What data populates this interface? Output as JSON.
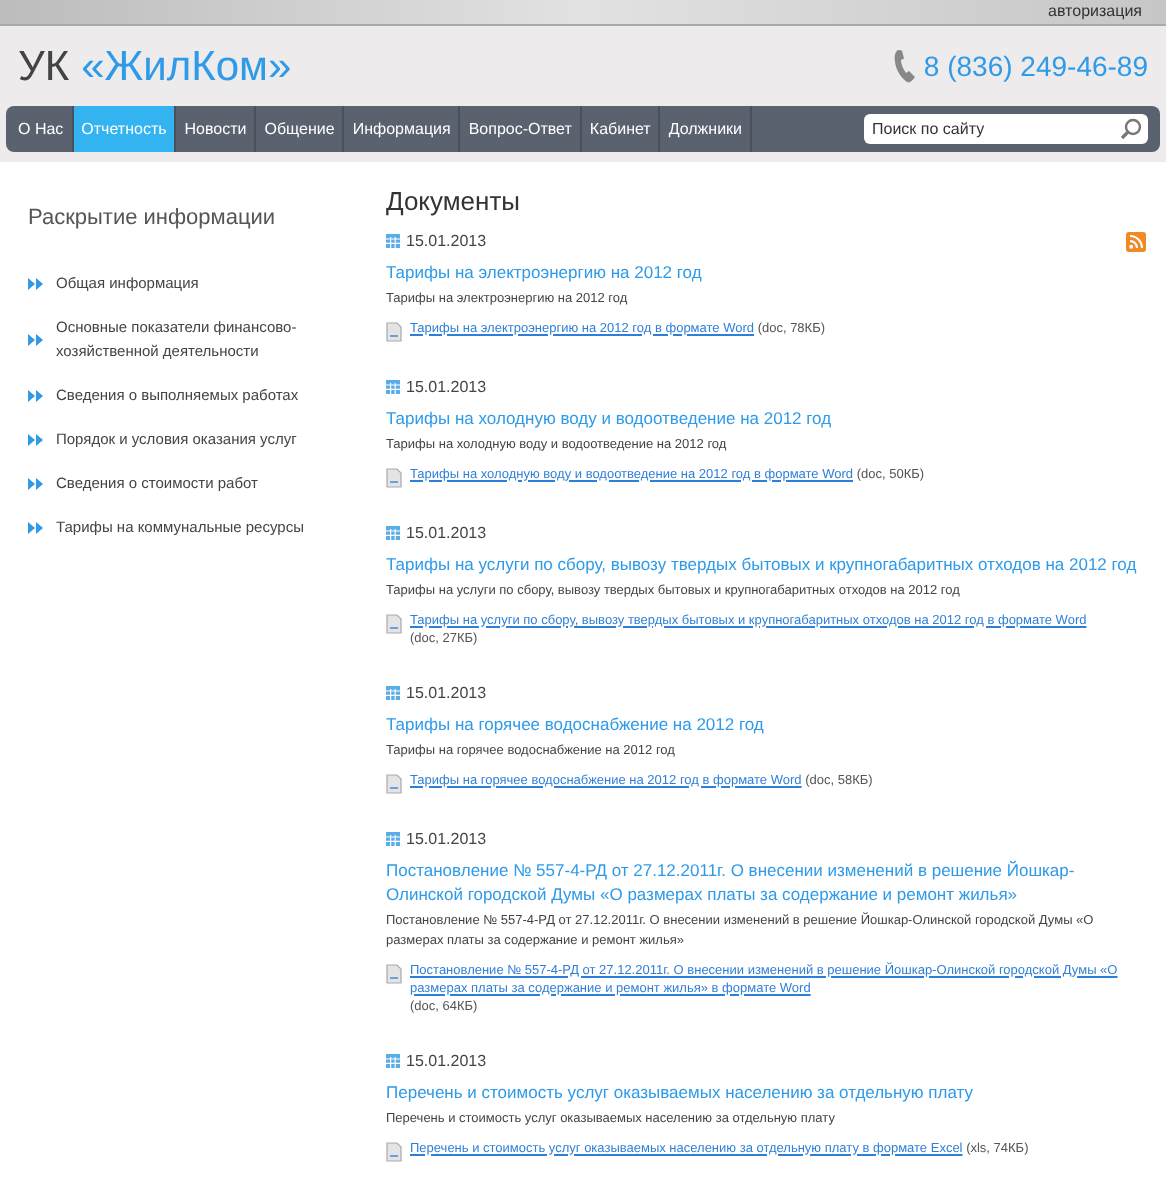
{
  "top_bar": {
    "login_link": "авторизация"
  },
  "header": {
    "logo_prefix": "УК",
    "logo_name": "«ЖилКом»",
    "phone": "8 (836) 249-46-89"
  },
  "nav": {
    "items": [
      {
        "label": "О Нас",
        "selected": false
      },
      {
        "label": "Отчетность",
        "selected": true
      },
      {
        "label": "Новости",
        "selected": false
      },
      {
        "label": "Общение",
        "selected": false
      },
      {
        "label": "Информация",
        "selected": false
      },
      {
        "label": "Вопрос-Ответ",
        "selected": false
      },
      {
        "label": "Кабинет",
        "selected": false
      },
      {
        "label": "Должники",
        "selected": false
      }
    ],
    "search": {
      "placeholder": "Поиск по сайту"
    }
  },
  "sidebar": {
    "title": "Раскрытие информации",
    "items": [
      "Общая информация",
      "Основные показатели финансово-хозяйственной деятельности",
      "Сведения о выполняемых работах",
      "Порядок и условия оказания услуг",
      "Сведения о стоимости работ",
      "Тарифы на коммунальные ресурсы"
    ]
  },
  "main": {
    "title": "Документы",
    "documents": [
      {
        "date": "15.01.2013",
        "title": "Тарифы на электроэнергию на 2012 год",
        "description": "Тарифы на электроэнергию на 2012 год",
        "file_link": "Тарифы на электроэнергию на 2012 год в формате Word",
        "file_info": "(doc, 78КБ)"
      },
      {
        "date": "15.01.2013",
        "title": "Тарифы на холодную воду и водоотведение на 2012 год",
        "description": "Тарифы на холодную воду и водоотведение на 2012 год",
        "file_link": "Тарифы на холодную воду и водоотведение на 2012 год в формате Word",
        "file_info": "(doc, 50КБ)"
      },
      {
        "date": "15.01.2013",
        "title": "Тарифы на услуги по сбору, вывозу твердых бытовых и крупногабаритных отходов на 2012 год",
        "description": "Тарифы на услуги по сбору, вывозу твердых бытовых и крупногабаритных отходов на 2012 год",
        "file_link": "Тарифы на услуги по сбору, вывозу твердых бытовых и крупногабаритных отходов на 2012 год в формате Word",
        "file_info": "(doc, 27КБ)"
      },
      {
        "date": "15.01.2013",
        "title": "Тарифы на горячее водоснабжение на 2012 год",
        "description": "Тарифы на горячее водоснабжение на 2012 год",
        "file_link": "Тарифы на горячее водоснабжение на 2012 год в формате Word",
        "file_info": "(doc, 58КБ)"
      },
      {
        "date": "15.01.2013",
        "title": "Постановление № 557-4-РД от 27.12.2011г. О внесении изменений в решение Йошкар-Олинской городской Думы «О размерах платы за содержание и ремонт жилья»",
        "description": "Постановление № 557-4-РД от 27.12.2011г. О внесении изменений в решение Йошкар-Олинской городской Думы «О размерах платы за содержание и ремонт жилья»",
        "file_link": "Постановление № 557-4-РД от 27.12.2011г. О внесении изменений в решение Йошкар-Олинской городской Думы «О размерах платы за содержание и ремонт жилья» в формате Word",
        "file_info": "(doc, 64КБ)"
      },
      {
        "date": "15.01.2013",
        "title": "Перечень и стоимость услуг оказываемых населению за отдельную плату",
        "description": "Перечень и стоимость услуг оказываемых населению за отдельную плату",
        "file_link": "Перечень и стоимость услуг оказываемых населению за отдельную плату в формате Excel",
        "file_info": "(xls, 74КБ)"
      }
    ]
  }
}
